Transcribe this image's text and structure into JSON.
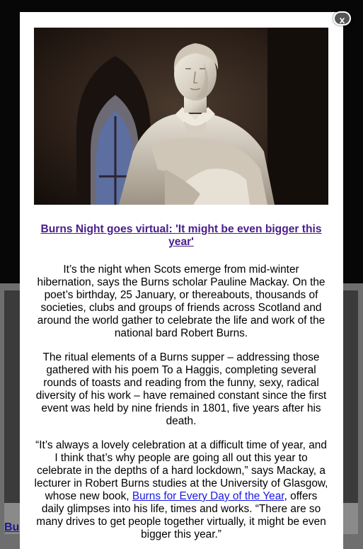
{
  "modal": {
    "close_label": "x",
    "headline": "Burns Night goes virtual: 'It might be even bigger this year'",
    "paragraphs": [
      "It’s the night when Scots emerge from mid-winter hibernation, says the Burns scholar Pauline Mackay. On the poet’s birthday, 25 January, or thereabouts, thousands of societies, clubs and groups of friends across Scotland and around the world gather to celebrate the life and work of the national bard Robert Burns.",
      "The ritual elements of a Burns supper – addressing those gathered with his poem To a Haggis, completing several rounds of toasts and reading from the funny, sexy, radical diversity of his work – have remained constant since the first event was held by nine friends in 1801, five years after his death."
    ],
    "quote": {
      "before_link": "“It’s always a lovely celebration at a difficult time of year, and I think that’s why people are going all out this year to celebrate in the depths of a hard lockdown,” says Mackay, a lecturer in Robert Burns studies at the University of Glasgow, whose new book, ",
      "link_text": "Burns for Every Day of the Year",
      "after_link": ", offers daily glimpses into his life, times and works. “There are so many drives to get people together virtually, it might be even bigger this year.”"
    }
  },
  "background": {
    "link_fragment": "Bu"
  }
}
